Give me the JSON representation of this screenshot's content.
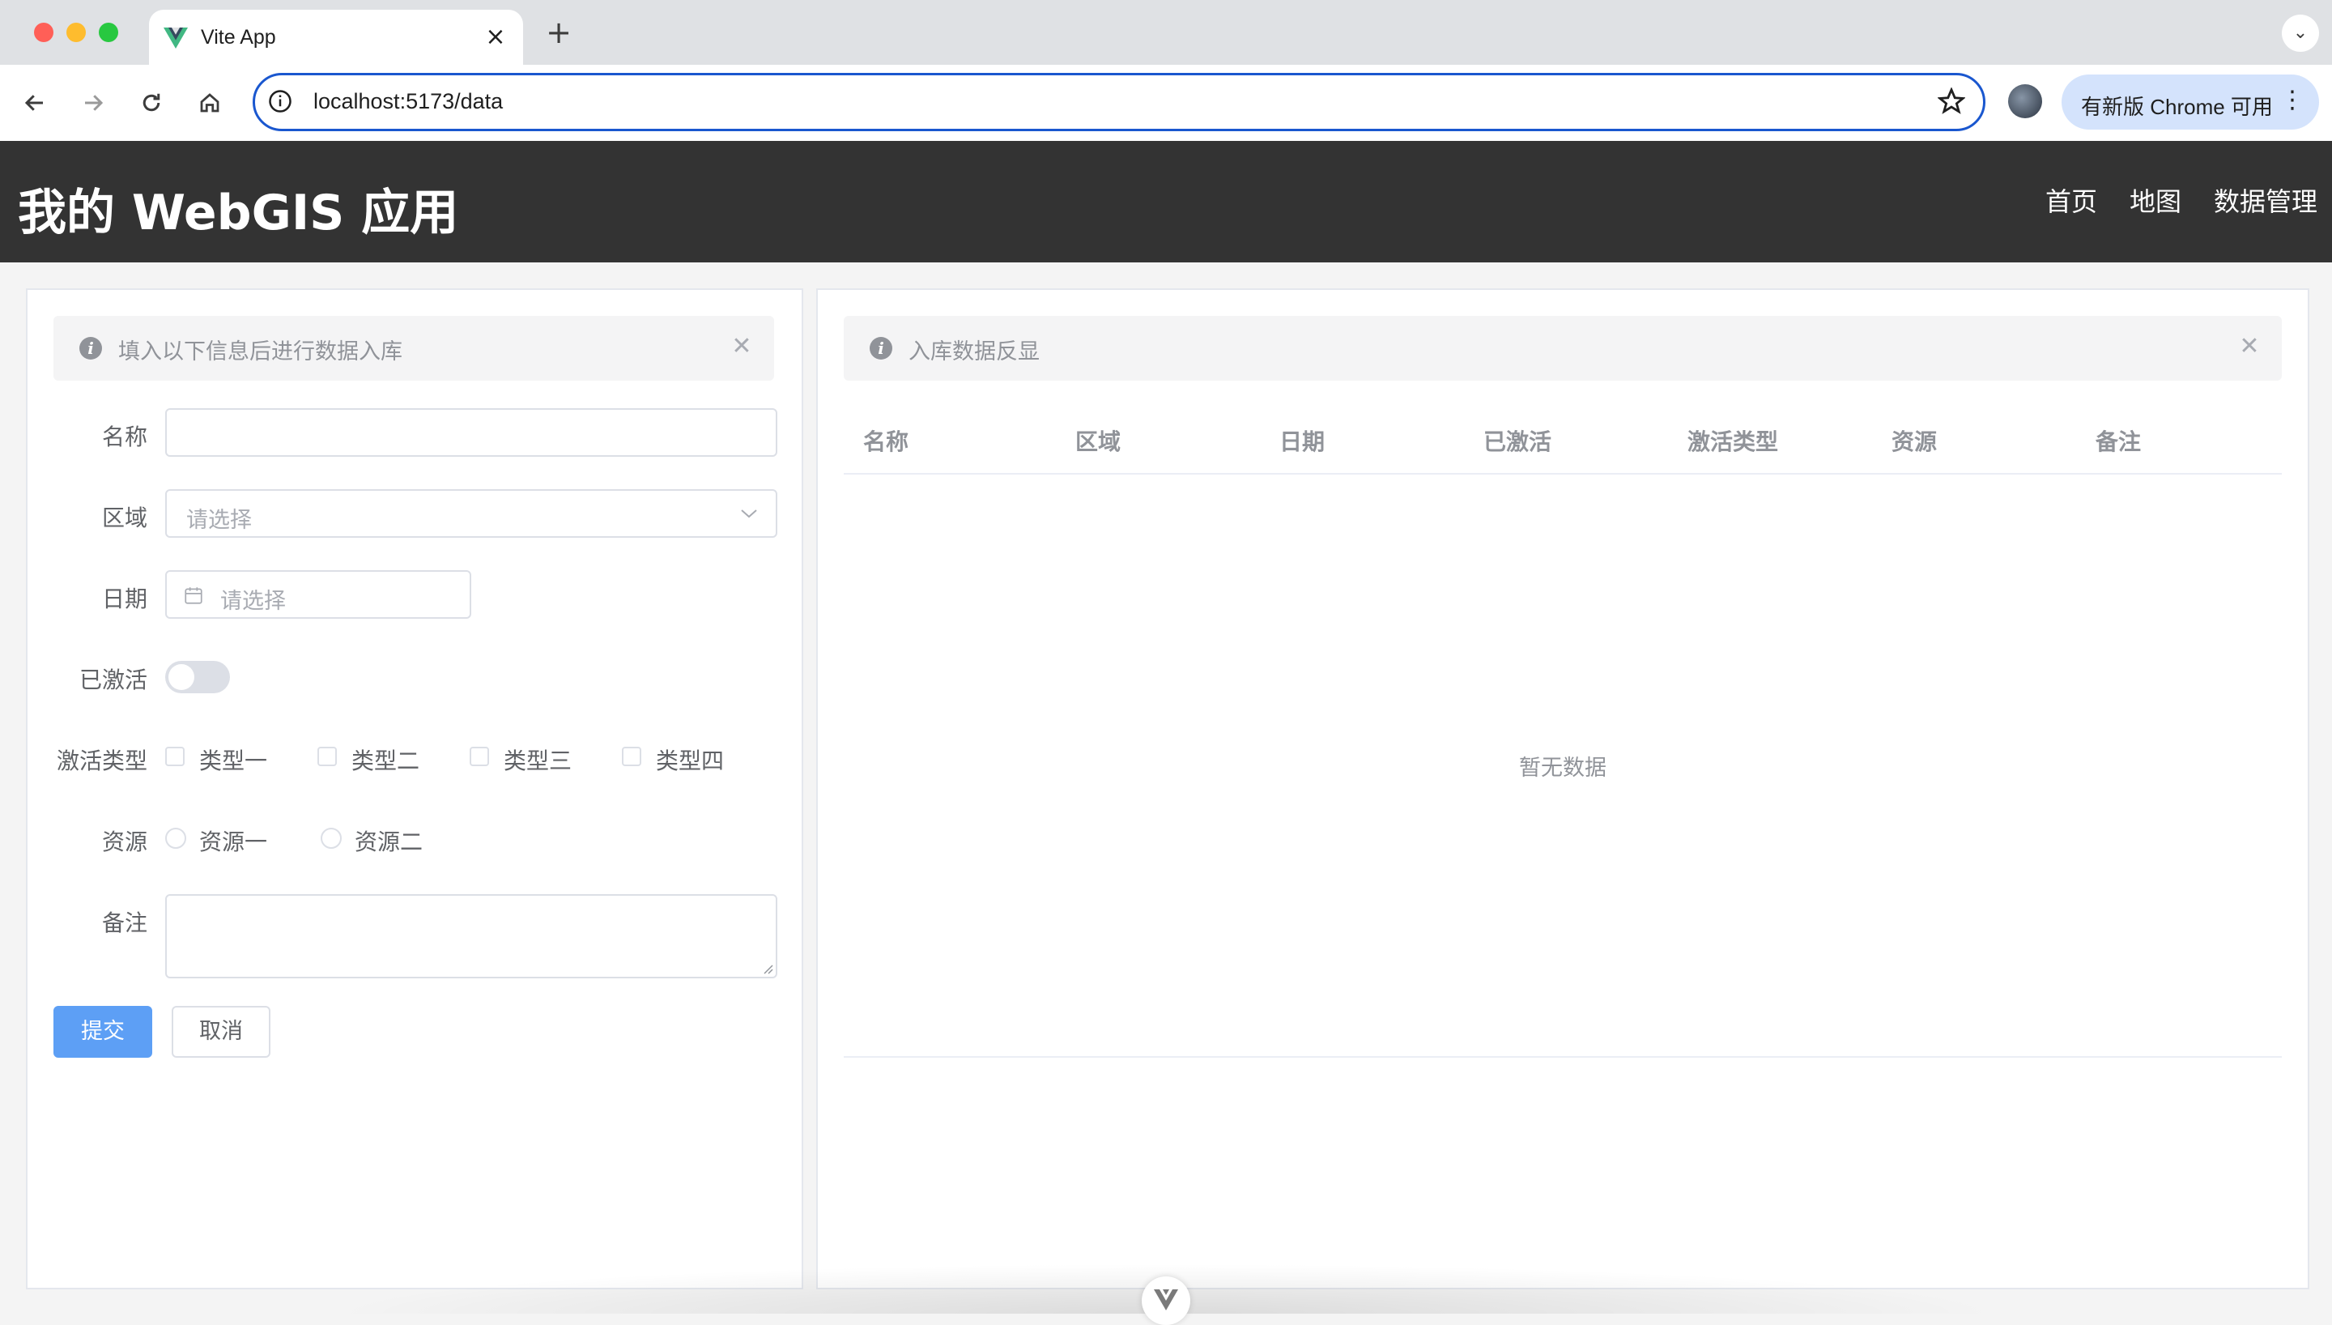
{
  "browser": {
    "tab_title": "Vite App",
    "new_tab": "+",
    "url": "localhost:5173/data",
    "update_label": "有新版 Chrome 可用"
  },
  "app": {
    "title": "我的 WebGIS 应用",
    "nav": [
      "首页",
      "地图",
      "数据管理"
    ]
  },
  "form_panel": {
    "alert_text": "填入以下信息后进行数据入库",
    "fields": {
      "name_label": "名称",
      "name_value": "",
      "region_label": "区域",
      "region_placeholder": "请选择",
      "date_label": "日期",
      "date_placeholder": "请选择",
      "activated_label": "已激活",
      "activated": false,
      "activation_type_label": "激活类型",
      "activation_types": [
        "类型一",
        "类型二",
        "类型三",
        "类型四"
      ],
      "resource_label": "资源",
      "resources": [
        "资源一",
        "资源二"
      ],
      "remark_label": "备注",
      "remark_value": ""
    },
    "submit_label": "提交",
    "cancel_label": "取消"
  },
  "table_panel": {
    "alert_text": "入库数据反显",
    "columns": [
      "名称",
      "区域",
      "日期",
      "已激活",
      "激活类型",
      "资源",
      "备注"
    ],
    "rows": [],
    "empty_text": "暂无数据"
  },
  "colors": {
    "header_bg": "#333333",
    "primary": "#5d9ff5",
    "omnibox_border": "#1a57cf"
  }
}
